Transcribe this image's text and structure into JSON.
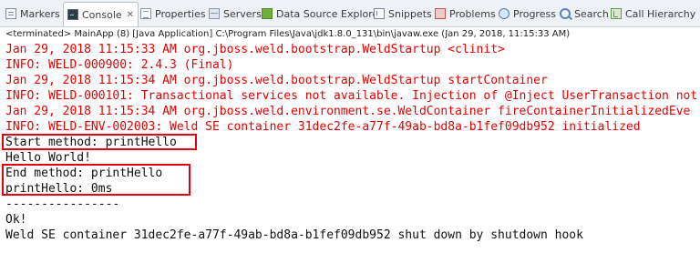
{
  "tabs": [
    {
      "label": "Markers",
      "icon": "markers-icon",
      "active": false
    },
    {
      "label": "Console",
      "icon": "console-icon",
      "active": true,
      "close": "✕"
    },
    {
      "label": "Properties",
      "icon": "properties-icon",
      "active": false
    },
    {
      "label": "Servers",
      "icon": "servers-icon",
      "active": false
    },
    {
      "label": "Data Source Explorer",
      "icon": "data-source-explorer-icon",
      "active": false
    },
    {
      "label": "Snippets",
      "icon": "snippets-icon",
      "active": false
    },
    {
      "label": "Problems",
      "icon": "problems-icon",
      "active": false
    },
    {
      "label": "Progress",
      "icon": "progress-icon",
      "active": false
    },
    {
      "label": "Search",
      "icon": "search-icon",
      "active": false
    },
    {
      "label": "Call Hierarchy",
      "icon": "call-hierarchy-icon",
      "active": false
    }
  ],
  "status": "<terminated> MainApp (8) [Java Application] C:\\Program Files\\Java\\jdk1.8.0_131\\bin\\javaw.exe (Jan 29, 2018, 11:15:33 AM)",
  "console": {
    "lines": [
      {
        "text": "Jan 29, 2018 11:15:33 AM org.jboss.weld.bootstrap.WeldStartup <clinit>",
        "stream": "stderr"
      },
      {
        "text": "INFO: WELD-000900: 2.4.3 (Final)",
        "stream": "stderr"
      },
      {
        "text": "Jan 29, 2018 11:15:34 AM org.jboss.weld.bootstrap.WeldStartup startContainer",
        "stream": "stderr"
      },
      {
        "text": "INFO: WELD-000101: Transactional services not available. Injection of @Inject UserTransaction not",
        "stream": "stderr"
      },
      {
        "text": "Jan 29, 2018 11:15:34 AM org.jboss.weld.environment.se.WeldContainer fireContainerInitializedEve",
        "stream": "stderr"
      },
      {
        "text": "INFO: WELD-ENV-002003: Weld SE container 31dec2fe-a77f-49ab-bd8a-b1fef09db952 initialized",
        "stream": "stderr"
      },
      {
        "text": "Start method: printHello",
        "stream": "stdout"
      },
      {
        "text": "Hello World!",
        "stream": "stdout"
      },
      {
        "text": "End method: printHello",
        "stream": "stdout"
      },
      {
        "text": "printHello: 0ms",
        "stream": "stdout"
      },
      {
        "text": "----------------",
        "stream": "stdout"
      },
      {
        "text": "Ok!",
        "stream": "stdout"
      },
      {
        "text": "Weld SE container 31dec2fe-a77f-49ab-bd8a-b1fef09db952 shut down by shutdown hook",
        "stream": "stdout"
      }
    ]
  },
  "colors": {
    "stderr": "#e60000",
    "stdout": "#111111",
    "highlight": "#e3000f",
    "tabbar": "#eef1f5"
  }
}
